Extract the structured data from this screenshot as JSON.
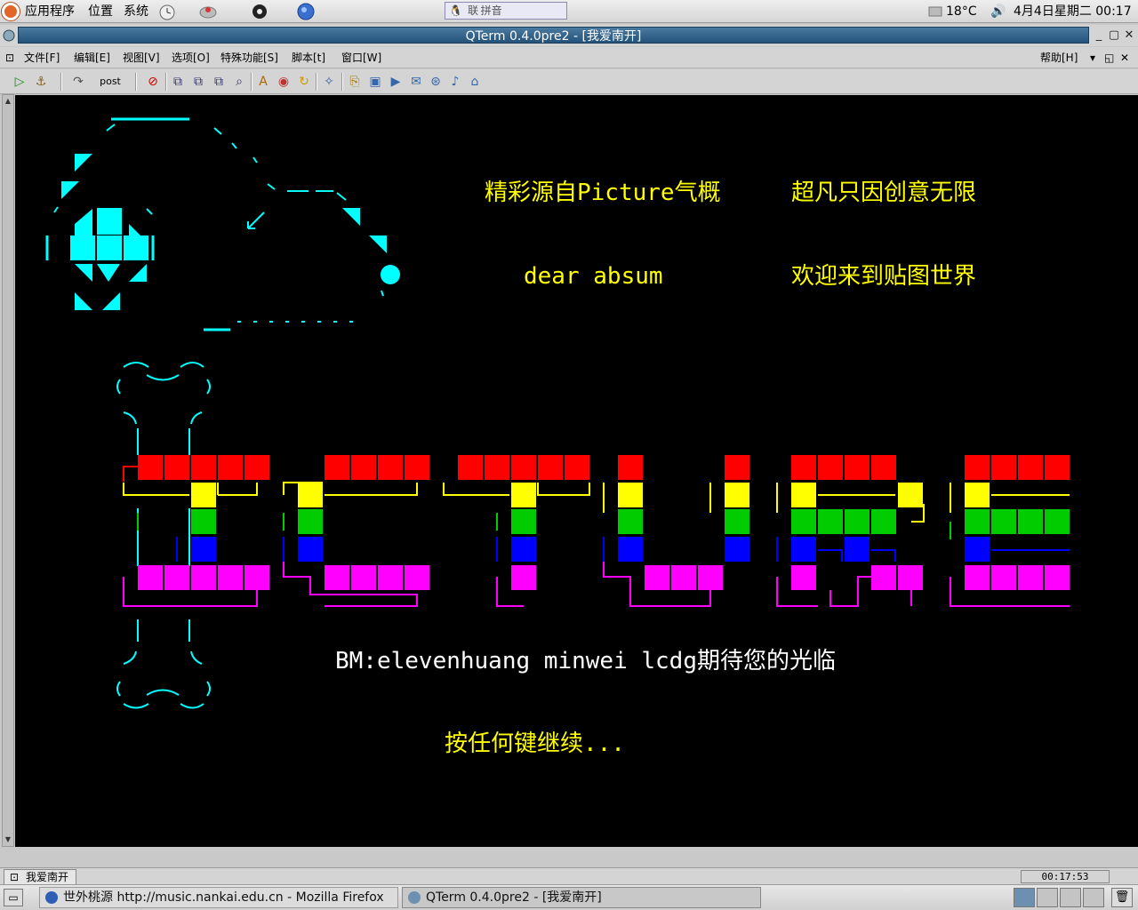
{
  "top_panel": {
    "menus": [
      "应用程序",
      "位置",
      "系统"
    ],
    "ime_text": " 联 拼音",
    "temperature": "18°C",
    "datetime": "4月4日星期二  00:17"
  },
  "window": {
    "title": "QTerm 0.4.0pre2 - [我爱南开]"
  },
  "menubar": {
    "items": [
      "文件[F]",
      "编辑[E]",
      "视图[V]",
      "选项[O]",
      "特殊功能[S]",
      "脚本[t]",
      "窗口[W]"
    ],
    "help": "帮助[H]"
  },
  "toolbar": {
    "post_label": "post"
  },
  "terminal": {
    "line1a": "精彩源自Picture气概",
    "line1b": "超凡只因创意无限",
    "line2a": "dear  absum",
    "line2b": "欢迎来到贴图世界",
    "bm_line": "BM:elevenhuang  minwei  lcdg期待您的光临",
    "press_any_key": "按任何键继续...",
    "colors": {
      "cyan": "#00ffff",
      "yellow": "#ffff00",
      "white": "#ffffff",
      "red": "#ff0000",
      "green": "#00cc00",
      "blue": "#0000ff",
      "magenta": "#ff00ff"
    }
  },
  "statusbar": {
    "tab_label": "我爱南开",
    "clock": "00:17:53"
  },
  "taskbar": {
    "tasks": [
      "世外桃源  http://music.nankai.edu.cn - Mozilla Firefox",
      "QTerm 0.4.0pre2 - [我爱南开]"
    ]
  }
}
